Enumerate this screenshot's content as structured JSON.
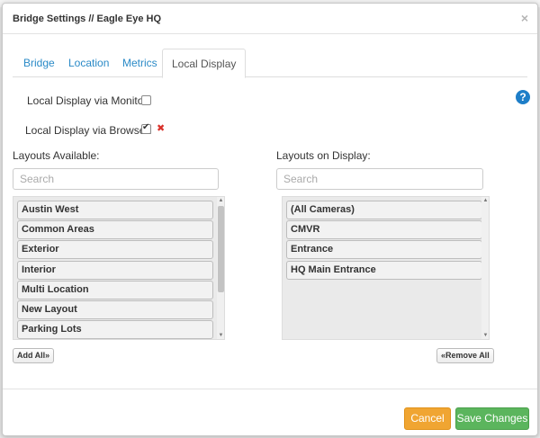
{
  "dialog": {
    "title": "Bridge Settings // Eagle Eye HQ",
    "close_glyph": "×"
  },
  "tabs": [
    {
      "label": "Bridge",
      "active": false
    },
    {
      "label": "Location",
      "active": false
    },
    {
      "label": "Metrics",
      "active": false
    },
    {
      "label": "Local Display",
      "active": true
    }
  ],
  "settings": {
    "monitor_label": "Local Display via Monitor:",
    "monitor_checked": false,
    "browser_label": "Local Display via Browser:",
    "browser_checked": true,
    "browser_remove_glyph": "✖",
    "help_glyph": "?"
  },
  "available": {
    "label": "Layouts Available:",
    "search_placeholder": "Search",
    "items": [
      "Austin West",
      "Common Areas",
      "Exterior",
      "Interior",
      "Multi Location",
      "New Layout",
      "Parking Lots"
    ],
    "add_all_label": "Add All»"
  },
  "on_display": {
    "label": "Layouts on Display:",
    "search_placeholder": "Search",
    "items": [
      "(All Cameras)",
      "CMVR",
      "Entrance",
      "HQ Main Entrance"
    ],
    "remove_all_label": "«Remove All"
  },
  "footer": {
    "cancel_label": "Cancel",
    "save_label": "Save Changes"
  },
  "colors": {
    "link_blue": "#2a8ac7",
    "cancel_orange": "#f0a532",
    "save_green": "#5bb55d",
    "help_blue": "#1e7ec8",
    "remove_red": "#d9312a"
  }
}
